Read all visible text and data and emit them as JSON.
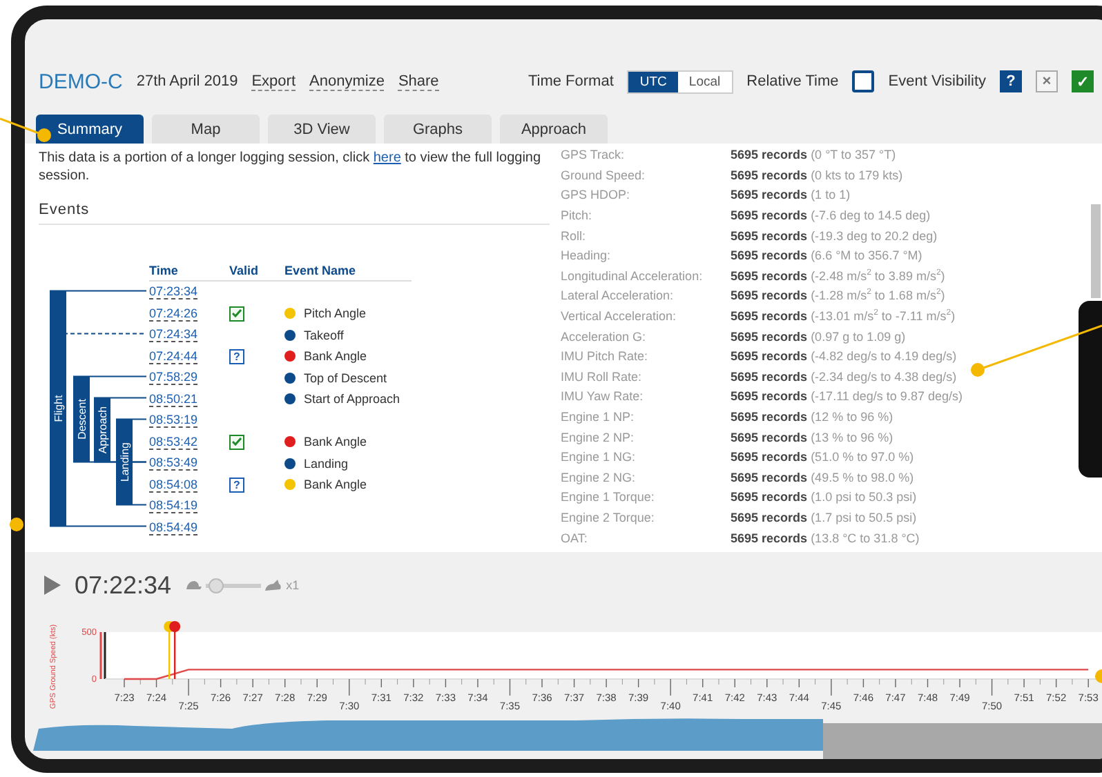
{
  "header": {
    "aircraft": "DEMO-C",
    "date": "27th April 2019",
    "links": [
      "Export",
      "Anonymize",
      "Share"
    ],
    "time_format": {
      "label": "Time Format",
      "options": [
        {
          "label": "UTC",
          "selected": true
        },
        {
          "label": "Local",
          "selected": false
        }
      ]
    },
    "relative_time": {
      "label": "Relative Time",
      "checked": false
    },
    "event_visibility": {
      "label": "Event Visibility",
      "buttons": [
        {
          "kind": "help",
          "label": "?"
        },
        {
          "kind": "hide",
          "label": "×"
        },
        {
          "kind": "show",
          "label": "✓"
        }
      ]
    }
  },
  "tabs": [
    {
      "label": "Summary",
      "selected": true
    },
    {
      "label": "Map",
      "selected": false
    },
    {
      "label": "3D View",
      "selected": false
    },
    {
      "label": "Graphs",
      "selected": false
    },
    {
      "label": "Approach",
      "selected": false
    }
  ],
  "summary": {
    "notice_before": "This data is a portion of a longer logging session, click",
    "notice_link": "here",
    "notice_after": "to view the full logging session.",
    "events_title": "Events",
    "columns": [
      "Time",
      "Valid",
      "Event Name"
    ],
    "phases": [
      {
        "label": "Flight"
      },
      {
        "label": "Descent"
      },
      {
        "label": "Approach"
      },
      {
        "label": "Landing"
      }
    ],
    "events": [
      {
        "time": "07:23:34",
        "kind": "plain"
      },
      {
        "time": "07:24:26",
        "kind": "confirmed",
        "color": "#f5c400",
        "name": "Pitch Angle"
      },
      {
        "time": "07:24:34",
        "kind": "plain",
        "color": "#0d4a8a",
        "name": "Takeoff"
      },
      {
        "time": "07:24:44",
        "kind": "unconfirmed",
        "valid_label": "?",
        "color": "#e01e1e",
        "name": "Bank Angle"
      },
      {
        "time": "07:58:29",
        "kind": "plain",
        "color": "#0d4a8a",
        "name": "Top of Descent"
      },
      {
        "time": "08:50:21",
        "kind": "plain",
        "color": "#0d4a8a",
        "name": "Start of Approach"
      },
      {
        "time": "08:53:19",
        "kind": "plain"
      },
      {
        "time": "08:53:42",
        "kind": "confirmed",
        "color": "#e01e1e",
        "name": "Bank Angle"
      },
      {
        "time": "08:53:49",
        "kind": "plain",
        "color": "#0d4a8a",
        "name": "Landing"
      },
      {
        "time": "08:54:08",
        "kind": "unconfirmed",
        "valid_label": "?",
        "color": "#f5c400",
        "name": "Bank Angle"
      },
      {
        "time": "08:54:19",
        "kind": "plain"
      },
      {
        "time": "08:54:49",
        "kind": "plain"
      }
    ],
    "records": [
      {
        "label": "GPS Track:",
        "count": "5695 records",
        "range": "(0 °T to 357 °T)"
      },
      {
        "label": "Ground Speed:",
        "count": "5695 records",
        "range": "(0 kts to 179 kts)"
      },
      {
        "label": "GPS HDOP:",
        "count": "5695 records",
        "range": "(1 to 1)"
      },
      {
        "label": "Pitch:",
        "count": "5695 records",
        "range": "(-7.6 deg to 14.5 deg)"
      },
      {
        "label": "Roll:",
        "count": "5695 records",
        "range": "(-19.3 deg to 20.2 deg)"
      },
      {
        "label": "Heading:",
        "count": "5695 records",
        "range": "(6.6 °M to 356.7 °M)"
      },
      {
        "label": "Longitudinal Acceleration:",
        "count": "5695 records",
        "range": "(-2.48 m/s$^{2}$ to 3.89 m/s$^{2}$)"
      },
      {
        "label": "Lateral Acceleration:",
        "count": "5695 records",
        "range": "(-1.28 m/s$^{2}$ to 1.68 m/s$^{2}$)"
      },
      {
        "label": "Vertical Acceleration:",
        "count": "5695 records",
        "range": "(-13.01 m/s$^{2}$ to -7.11 m/s$^{2}$)"
      },
      {
        "label": "Acceleration G:",
        "count": "5695 records",
        "range": "(0.97 g to 1.09 g)"
      },
      {
        "label": "IMU Pitch Rate:",
        "count": "5695 records",
        "range": "(-4.82 deg/s to 4.19 deg/s)"
      },
      {
        "label": "IMU Roll Rate:",
        "count": "5695 records",
        "range": "(-2.34 deg/s to 4.38 deg/s)"
      },
      {
        "label": "IMU Yaw Rate:",
        "count": "5695 records",
        "range": "(-17.11 deg/s to 9.87 deg/s)"
      },
      {
        "label": "Engine 1 NP:",
        "count": "5695 records",
        "range": "(12 % to 96 %)"
      },
      {
        "label": "Engine 2 NP:",
        "count": "5695 records",
        "range": "(13 % to 96 %)"
      },
      {
        "label": "Engine 1 NG:",
        "count": "5695 records",
        "range": "(51.0 % to 97.0 %)"
      },
      {
        "label": "Engine 2 NG:",
        "count": "5695 records",
        "range": "(49.5 % to 98.0 %)"
      },
      {
        "label": "Engine 1 Torque:",
        "count": "5695 records",
        "range": "(1.0 psi to 50.3 psi)"
      },
      {
        "label": "Engine 2 Torque:",
        "count": "5695 records",
        "range": "(1.7 psi to 50.5 psi)"
      },
      {
        "label": "OAT:",
        "count": "5695 records",
        "range": "(13.8 °C to 31.8 °C)"
      }
    ]
  },
  "player": {
    "time": "07:22:34",
    "speed": {
      "level": 0.05,
      "reading": "x1"
    }
  },
  "timeline": {
    "chart_data": {
      "type": "line",
      "ylabel": "GPS Ground Speed (kts)",
      "yticks": [
        0,
        500
      ],
      "ylim": [
        0,
        500
      ],
      "categories": [
        "7:23",
        "7:24",
        "7:25",
        "7:26",
        "7:27",
        "7:28",
        "7:29",
        "7:30",
        "7:31",
        "7:32",
        "7:33",
        "7:34",
        "7:35",
        "7:36",
        "7:37",
        "7:38",
        "7:39",
        "7:40",
        "7:41",
        "7:42",
        "7:43",
        "7:44",
        "7:45",
        "7:46",
        "7:47",
        "7:48",
        "7:49",
        "7:50",
        "7:51",
        "7:52",
        "7:53"
      ],
      "series": [
        {
          "color": "#e04848",
          "values": [
            0,
            0,
            100,
            100,
            100,
            100,
            100,
            100,
            100,
            100,
            100,
            100,
            100,
            100,
            100,
            100,
            100,
            100,
            100,
            100,
            100,
            100,
            100,
            100,
            100,
            100,
            100,
            100,
            100,
            100,
            100
          ]
        }
      ]
    },
    "event_markers": [
      {
        "color": "#f5c400"
      },
      {
        "color": "#e01e1e"
      }
    ]
  }
}
